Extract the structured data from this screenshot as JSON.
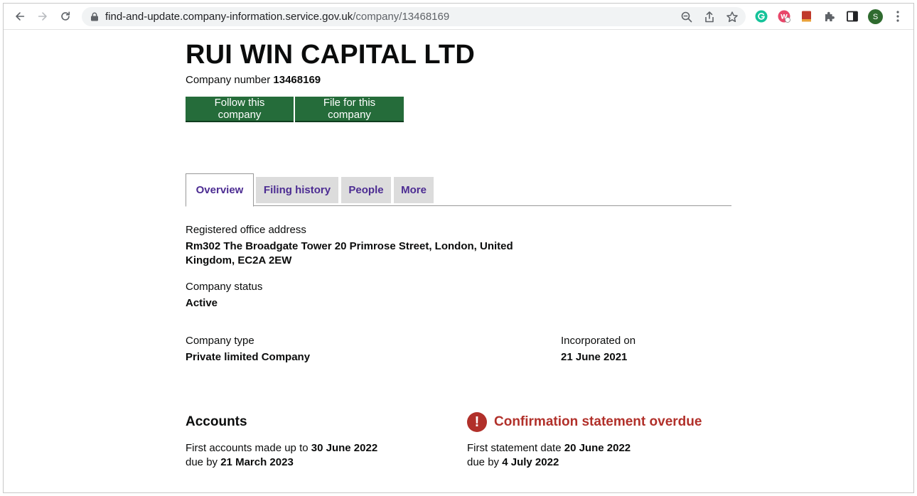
{
  "browser": {
    "url_host": "find-and-update.company-information.service.gov.uk",
    "url_path": "/company/13468169",
    "profile_initial": "S"
  },
  "company": {
    "name": "RUI WIN CAPITAL LTD",
    "number_label": "Company number",
    "number": "13468169"
  },
  "actions": {
    "follow_label": "Follow this company",
    "file_label": "File for this company"
  },
  "tabs": [
    {
      "label": "Overview",
      "active": true
    },
    {
      "label": "Filing history",
      "active": false
    },
    {
      "label": "People",
      "active": false
    },
    {
      "label": "More",
      "active": false
    }
  ],
  "overview": {
    "address_label": "Registered office address",
    "address_line1": "Rm302 The Broadgate Tower 20 Primrose Street, London, United",
    "address_line2": "Kingdom, EC2A 2EW",
    "status_label": "Company status",
    "status_value": "Active",
    "type_label": "Company type",
    "type_value": "Private limited Company",
    "incorporated_label": "Incorporated on",
    "incorporated_value": "21 June 2021"
  },
  "accounts": {
    "heading": "Accounts",
    "first_label": "First accounts made up to",
    "first_value": "30 June 2022",
    "due_label": "due by",
    "due_value": "21 March 2023"
  },
  "confirmation": {
    "heading": "Confirmation statement overdue",
    "warning_glyph": "!",
    "first_label": "First statement date",
    "first_value": "20 June 2022",
    "due_label": "due by",
    "due_value": "4 July 2022"
  },
  "colors": {
    "button_green": "#256c3a",
    "tab_link_purple": "#4c2c92",
    "overdue_red": "#b1302a"
  }
}
